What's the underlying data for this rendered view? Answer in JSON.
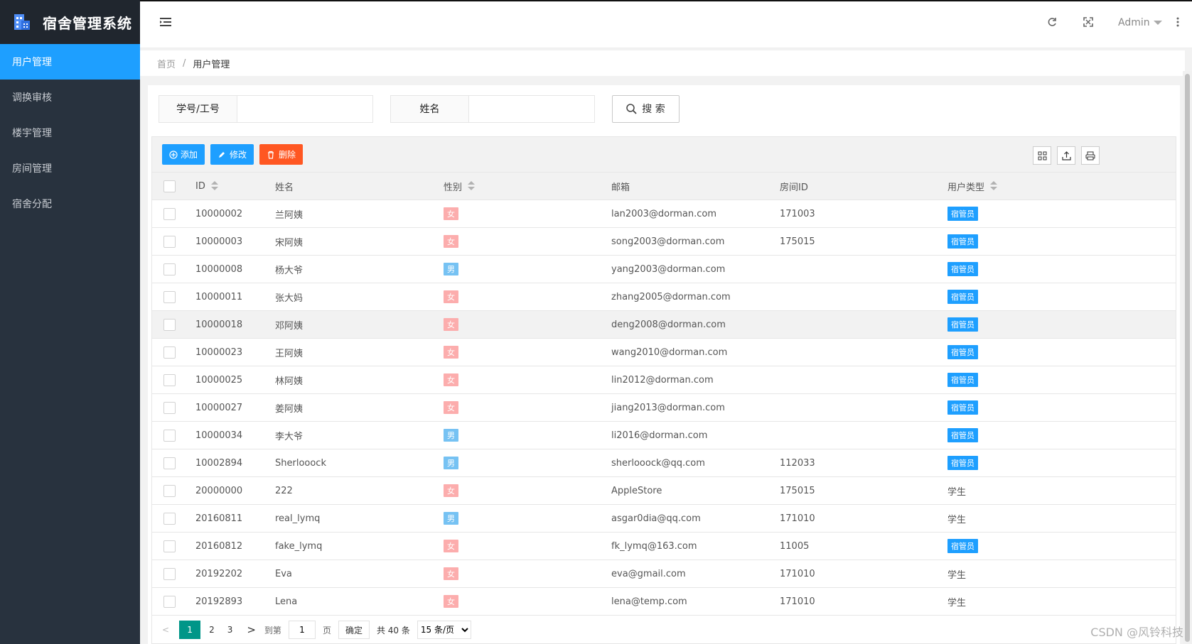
{
  "app": {
    "title": "宿舍管理系统"
  },
  "sidebar": {
    "items": [
      {
        "label": "用户管理",
        "active": true
      },
      {
        "label": "调换审核",
        "active": false
      },
      {
        "label": "楼宇管理",
        "active": false
      },
      {
        "label": "房间管理",
        "active": false
      },
      {
        "label": "宿舍分配",
        "active": false
      }
    ]
  },
  "topbar": {
    "user": "Admin"
  },
  "breadcrumb": {
    "home": "首页",
    "sep": "/",
    "current": "用户管理"
  },
  "search": {
    "field1_label": "学号/工号",
    "field1_value": "",
    "field2_label": "姓名",
    "field2_value": "",
    "button_label": "搜 索"
  },
  "toolbar": {
    "add_label": "添加",
    "edit_label": "修改",
    "delete_label": "删除"
  },
  "table": {
    "headers": {
      "id": "ID",
      "name": "姓名",
      "gender": "性别",
      "email": "邮箱",
      "room": "房间ID",
      "type": "用户类型"
    },
    "rows": [
      {
        "id": "10000002",
        "name": "兰阿姨",
        "gender": "女",
        "email": "lan2003@dorman.com",
        "room": "171003",
        "type": "宿管员"
      },
      {
        "id": "10000003",
        "name": "宋阿姨",
        "gender": "女",
        "email": "song2003@dorman.com",
        "room": "175015",
        "type": "宿管员"
      },
      {
        "id": "10000008",
        "name": "杨大爷",
        "gender": "男",
        "email": "yang2003@dorman.com",
        "room": "",
        "type": "宿管员"
      },
      {
        "id": "10000011",
        "name": "张大妈",
        "gender": "女",
        "email": "zhang2005@dorman.com",
        "room": "",
        "type": "宿管员"
      },
      {
        "id": "10000018",
        "name": "邓阿姨",
        "gender": "女",
        "email": "deng2008@dorman.com",
        "room": "",
        "type": "宿管员"
      },
      {
        "id": "10000023",
        "name": "王阿姨",
        "gender": "女",
        "email": "wang2010@dorman.com",
        "room": "",
        "type": "宿管员"
      },
      {
        "id": "10000025",
        "name": "林阿姨",
        "gender": "女",
        "email": "lin2012@dorman.com",
        "room": "",
        "type": "宿管员"
      },
      {
        "id": "10000027",
        "name": "姜阿姨",
        "gender": "女",
        "email": "jiang2013@dorman.com",
        "room": "",
        "type": "宿管员"
      },
      {
        "id": "10000034",
        "name": "李大爷",
        "gender": "男",
        "email": "li2016@dorman.com",
        "room": "",
        "type": "宿管员"
      },
      {
        "id": "10002894",
        "name": "Sherlooock",
        "gender": "男",
        "email": "sherlooock@qq.com",
        "room": "112033",
        "type": "宿管员"
      },
      {
        "id": "20000000",
        "name": "222",
        "gender": "女",
        "email": "AppleStore",
        "room": "175015",
        "type": "学生"
      },
      {
        "id": "20160811",
        "name": "real_lymq",
        "gender": "男",
        "email": "asgar0dia@qq.com",
        "room": "171010",
        "type": "学生"
      },
      {
        "id": "20160812",
        "name": "fake_lymq",
        "gender": "女",
        "email": "fk_lymq@163.com",
        "room": "11005",
        "type": "宿管员"
      },
      {
        "id": "20192202",
        "name": "Eva",
        "gender": "女",
        "email": "eva@gmail.com",
        "room": "171010",
        "type": "学生"
      },
      {
        "id": "20192893",
        "name": "Lena",
        "gender": "女",
        "email": "lena@temp.com",
        "room": "171010",
        "type": "学生"
      }
    ]
  },
  "pagination": {
    "prev": "<",
    "pages": [
      "1",
      "2",
      "3"
    ],
    "current": "1",
    "next": ">",
    "goto_label": "到第",
    "goto_value": "1",
    "page_unit": "页",
    "confirm_label": "确定",
    "total_label": "共 40 条",
    "page_size_option": "15 条/页"
  },
  "watermark": "CSDN @风铃科技",
  "colors": {
    "sidebar": "#28323e",
    "accent": "#1e9fff",
    "danger": "#ff5722",
    "female": "#fcadad",
    "male": "#76c2f3",
    "page_active": "#009688"
  }
}
